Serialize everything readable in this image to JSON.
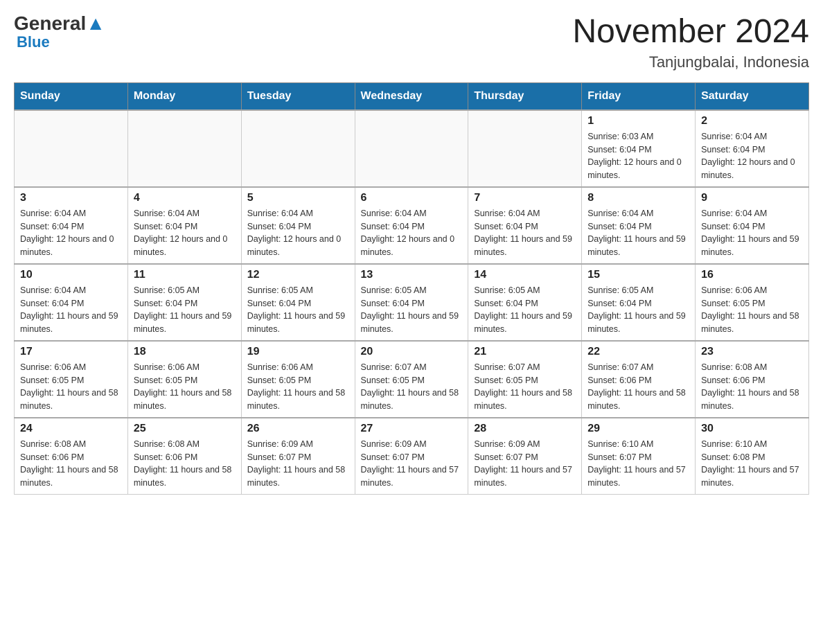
{
  "header": {
    "logo": {
      "general": "General",
      "blue": "Blue"
    },
    "title": "November 2024",
    "location": "Tanjungbalai, Indonesia"
  },
  "weekdays": [
    "Sunday",
    "Monday",
    "Tuesday",
    "Wednesday",
    "Thursday",
    "Friday",
    "Saturday"
  ],
  "weeks": [
    [
      {
        "day": "",
        "info": ""
      },
      {
        "day": "",
        "info": ""
      },
      {
        "day": "",
        "info": ""
      },
      {
        "day": "",
        "info": ""
      },
      {
        "day": "",
        "info": ""
      },
      {
        "day": "1",
        "info": "Sunrise: 6:03 AM\nSunset: 6:04 PM\nDaylight: 12 hours and 0 minutes."
      },
      {
        "day": "2",
        "info": "Sunrise: 6:04 AM\nSunset: 6:04 PM\nDaylight: 12 hours and 0 minutes."
      }
    ],
    [
      {
        "day": "3",
        "info": "Sunrise: 6:04 AM\nSunset: 6:04 PM\nDaylight: 12 hours and 0 minutes."
      },
      {
        "day": "4",
        "info": "Sunrise: 6:04 AM\nSunset: 6:04 PM\nDaylight: 12 hours and 0 minutes."
      },
      {
        "day": "5",
        "info": "Sunrise: 6:04 AM\nSunset: 6:04 PM\nDaylight: 12 hours and 0 minutes."
      },
      {
        "day": "6",
        "info": "Sunrise: 6:04 AM\nSunset: 6:04 PM\nDaylight: 12 hours and 0 minutes."
      },
      {
        "day": "7",
        "info": "Sunrise: 6:04 AM\nSunset: 6:04 PM\nDaylight: 11 hours and 59 minutes."
      },
      {
        "day": "8",
        "info": "Sunrise: 6:04 AM\nSunset: 6:04 PM\nDaylight: 11 hours and 59 minutes."
      },
      {
        "day": "9",
        "info": "Sunrise: 6:04 AM\nSunset: 6:04 PM\nDaylight: 11 hours and 59 minutes."
      }
    ],
    [
      {
        "day": "10",
        "info": "Sunrise: 6:04 AM\nSunset: 6:04 PM\nDaylight: 11 hours and 59 minutes."
      },
      {
        "day": "11",
        "info": "Sunrise: 6:05 AM\nSunset: 6:04 PM\nDaylight: 11 hours and 59 minutes."
      },
      {
        "day": "12",
        "info": "Sunrise: 6:05 AM\nSunset: 6:04 PM\nDaylight: 11 hours and 59 minutes."
      },
      {
        "day": "13",
        "info": "Sunrise: 6:05 AM\nSunset: 6:04 PM\nDaylight: 11 hours and 59 minutes."
      },
      {
        "day": "14",
        "info": "Sunrise: 6:05 AM\nSunset: 6:04 PM\nDaylight: 11 hours and 59 minutes."
      },
      {
        "day": "15",
        "info": "Sunrise: 6:05 AM\nSunset: 6:04 PM\nDaylight: 11 hours and 59 minutes."
      },
      {
        "day": "16",
        "info": "Sunrise: 6:06 AM\nSunset: 6:05 PM\nDaylight: 11 hours and 58 minutes."
      }
    ],
    [
      {
        "day": "17",
        "info": "Sunrise: 6:06 AM\nSunset: 6:05 PM\nDaylight: 11 hours and 58 minutes."
      },
      {
        "day": "18",
        "info": "Sunrise: 6:06 AM\nSunset: 6:05 PM\nDaylight: 11 hours and 58 minutes."
      },
      {
        "day": "19",
        "info": "Sunrise: 6:06 AM\nSunset: 6:05 PM\nDaylight: 11 hours and 58 minutes."
      },
      {
        "day": "20",
        "info": "Sunrise: 6:07 AM\nSunset: 6:05 PM\nDaylight: 11 hours and 58 minutes."
      },
      {
        "day": "21",
        "info": "Sunrise: 6:07 AM\nSunset: 6:05 PM\nDaylight: 11 hours and 58 minutes."
      },
      {
        "day": "22",
        "info": "Sunrise: 6:07 AM\nSunset: 6:06 PM\nDaylight: 11 hours and 58 minutes."
      },
      {
        "day": "23",
        "info": "Sunrise: 6:08 AM\nSunset: 6:06 PM\nDaylight: 11 hours and 58 minutes."
      }
    ],
    [
      {
        "day": "24",
        "info": "Sunrise: 6:08 AM\nSunset: 6:06 PM\nDaylight: 11 hours and 58 minutes."
      },
      {
        "day": "25",
        "info": "Sunrise: 6:08 AM\nSunset: 6:06 PM\nDaylight: 11 hours and 58 minutes."
      },
      {
        "day": "26",
        "info": "Sunrise: 6:09 AM\nSunset: 6:07 PM\nDaylight: 11 hours and 58 minutes."
      },
      {
        "day": "27",
        "info": "Sunrise: 6:09 AM\nSunset: 6:07 PM\nDaylight: 11 hours and 57 minutes."
      },
      {
        "day": "28",
        "info": "Sunrise: 6:09 AM\nSunset: 6:07 PM\nDaylight: 11 hours and 57 minutes."
      },
      {
        "day": "29",
        "info": "Sunrise: 6:10 AM\nSunset: 6:07 PM\nDaylight: 11 hours and 57 minutes."
      },
      {
        "day": "30",
        "info": "Sunrise: 6:10 AM\nSunset: 6:08 PM\nDaylight: 11 hours and 57 minutes."
      }
    ]
  ]
}
